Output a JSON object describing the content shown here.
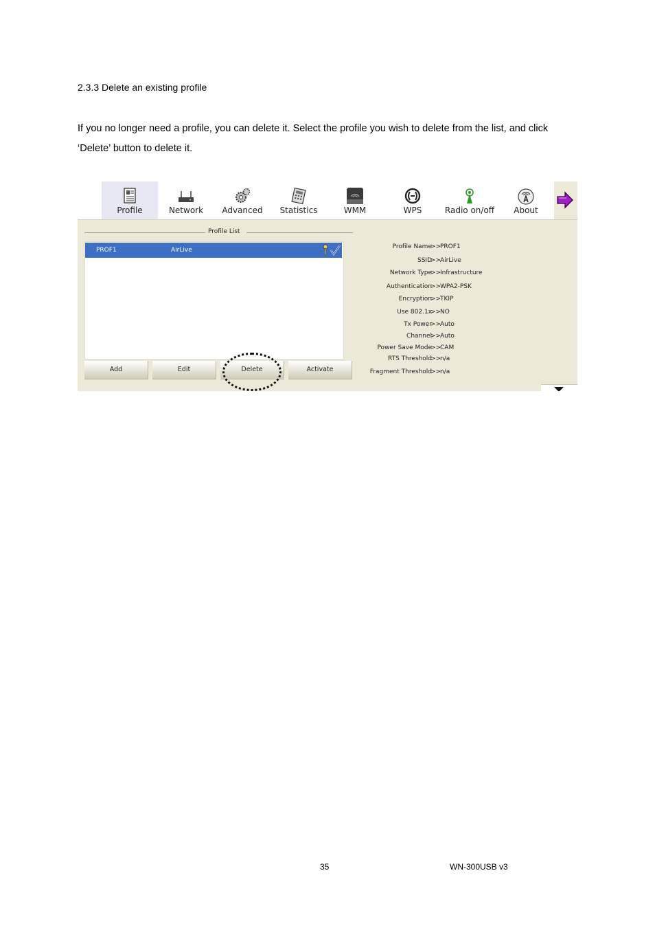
{
  "document": {
    "heading": "2.3.3 Delete an existing profile",
    "paragraph": "If you no longer need a profile, you can delete it. Select the profile you wish to delete from the list, and click ‘Delete’ button to delete it.",
    "page_number": "35",
    "model": "WN-300USB  v3"
  },
  "ui": {
    "toolbar": {
      "items": [
        {
          "label": "Profile",
          "icon": "profile-icon"
        },
        {
          "label": "Network",
          "icon": "network-icon"
        },
        {
          "label": "Advanced",
          "icon": "advanced-icon"
        },
        {
          "label": "Statistics",
          "icon": "statistics-icon"
        },
        {
          "label": "WMM",
          "icon": "wmm-icon"
        },
        {
          "label": "WPS",
          "icon": "wps-icon"
        },
        {
          "label": "Radio on/off",
          "icon": "radio-icon"
        },
        {
          "label": "About",
          "icon": "about-icon"
        }
      ],
      "active": "Profile",
      "arrow_icon": "next-arrow-icon"
    },
    "profile_list": {
      "title": "Profile List",
      "rows": [
        {
          "name": "PROF1",
          "ssid": "AirLive"
        }
      ]
    },
    "buttons": {
      "add": "Add",
      "edit": "Edit",
      "delete": "Delete",
      "activate": "Activate"
    },
    "details": [
      {
        "label": "Profile Name",
        "value": "PROF1"
      },
      {
        "label": "SSID",
        "value": "AirLive"
      },
      {
        "label": "Network Type",
        "value": "Infrastructure"
      },
      {
        "label": "Authentication",
        "value": "WPA2-PSK"
      },
      {
        "label": "Encryption",
        "value": "TKIP"
      },
      {
        "label": "Use 802.1x",
        "value": "NO"
      },
      {
        "label": "Tx Power",
        "value": "Auto"
      },
      {
        "label": "Channel",
        "value": "Auto"
      },
      {
        "label": "Power Save Mode",
        "value": "CAM"
      },
      {
        "label": "RTS Threshold",
        "value": "n/a"
      },
      {
        "label": "Fragment Threshold",
        "value": "n/a"
      }
    ],
    "separator": ">>",
    "colors": {
      "selection": "#3d6fc5",
      "panel": "#ece9d8",
      "arrow": "#a020c0"
    }
  }
}
